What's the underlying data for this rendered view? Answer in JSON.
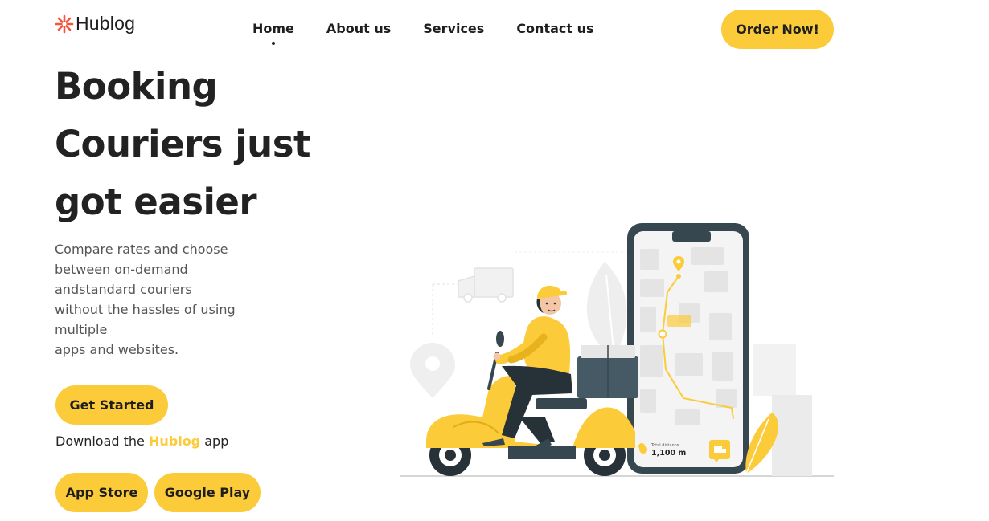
{
  "brand": {
    "name": "Hublog"
  },
  "nav": {
    "items": [
      {
        "label": "Home",
        "active": true
      },
      {
        "label": "About us",
        "active": false
      },
      {
        "label": "Services",
        "active": false
      },
      {
        "label": "Contact us",
        "active": false
      }
    ]
  },
  "header": {
    "order_label": "Order Now!"
  },
  "hero": {
    "title": "Booking Couriers just got easier",
    "description": "Compare rates and choose\nbetween on-demand\nandstandard couriers\nwithout the hassles of using\nmultiple\napps and websites.",
    "cta_label": "Get Started",
    "download_prefix": "Download the",
    "download_brand": "Hublog",
    "download_suffix": "app",
    "app_store_label": "App Store",
    "google_play_label": "Google Play"
  },
  "illustration": {
    "distance_label": "Total distance",
    "distance_value": "1,100 m",
    "icons": [
      "delivery-truck-icon",
      "map-pin-icon",
      "courier-scooter-icon"
    ]
  },
  "colors": {
    "accent": "#fbcb3a",
    "text_dark": "#222222",
    "text_muted": "#555555",
    "phone_dark": "#37474f"
  }
}
